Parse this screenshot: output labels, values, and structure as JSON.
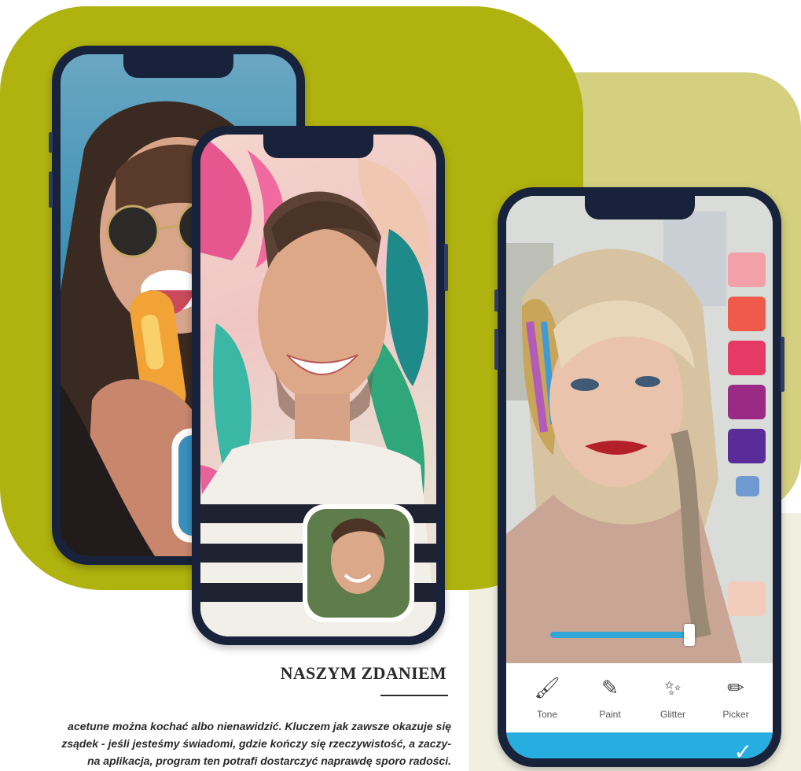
{
  "colors": {
    "olive_blob": "#b0b20f",
    "light_blob": "#d5cf80",
    "cream_strip": "#f1efe0",
    "phone_frame": "#18223a",
    "accent_blue": "#27aee1"
  },
  "phone3": {
    "swatches": [
      "#f4a0a8",
      "#ef5a4b",
      "#e63a66",
      "#9a2a83",
      "#5a2c99",
      "#6f9ad0",
      "#f6c9b6"
    ],
    "slider_fraction": 0.95,
    "tools": [
      {
        "label": "Tone",
        "icon": "brush-icon"
      },
      {
        "label": "Paint",
        "icon": "marker-icon"
      },
      {
        "label": "Glitter",
        "icon": "glitter-icon"
      },
      {
        "label": "Picker",
        "icon": "pencil-icon"
      }
    ]
  },
  "article": {
    "heading": "NASZYM ZDANIEM",
    "lines": [
      "acetune można kochać albo nienawidzić. Kluczem jak zawsze okazuje się",
      "zsądek - jeśli jesteśmy świadomi, gdzie kończy się rzeczywistość, a zaczy-",
      "na aplikacja, program ten potrafi dostarczyć naprawdę sporo radości."
    ]
  }
}
